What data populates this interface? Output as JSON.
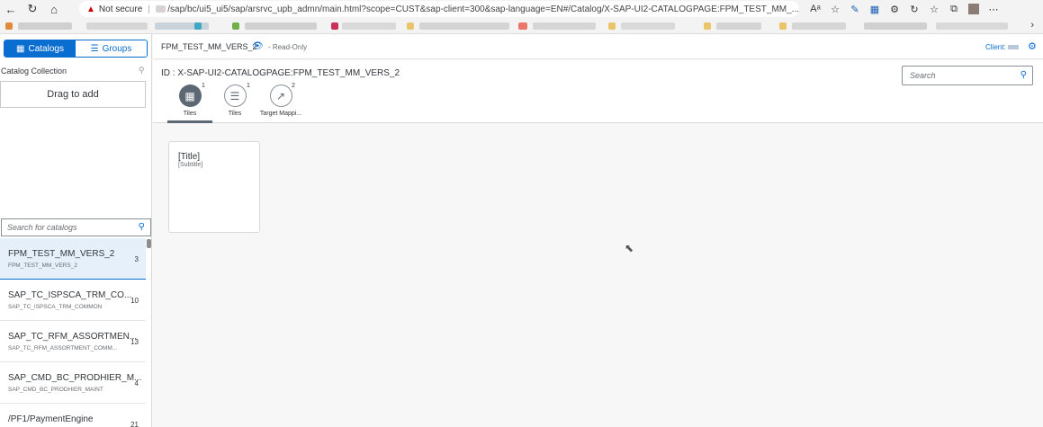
{
  "browser": {
    "security_label": "Not secure",
    "url": "/sap/bc/ui5_ui5/sap/arsrvc_upb_admn/main.html?scope=CUST&sap-client=300&sap-language=EN#/Catalog/X-SAP-UI2-CATALOGPAGE:FPM_TEST_MM_..."
  },
  "sidebar": {
    "seg_catalogs": "Catalogs",
    "seg_groups": "Groups",
    "collection_label": "Catalog Collection",
    "drop_label": "Drag to add",
    "search_placeholder": "Search for catalogs",
    "items": [
      {
        "title": "FPM_TEST_MM_VERS_2",
        "subtitle": "FPM_TEST_MM_VERS_2",
        "count": "3"
      },
      {
        "title": "SAP_TC_ISPSCA_TRM_CO...",
        "subtitle": "SAP_TC_ISPSCA_TRM_COMMON",
        "count": "10"
      },
      {
        "title": "SAP_TC_RFM_ASSORTMEN...",
        "subtitle": "SAP_TC_RFM_ASSORTMENT_COMM...",
        "count": "13"
      },
      {
        "title": "SAP_CMD_BC_PRODHIER_M...",
        "subtitle": "SAP_CMD_BC_PRODHIER_MAINT",
        "count": "4"
      },
      {
        "title": "/PF1/PaymentEngine",
        "subtitle": "",
        "count": "21"
      }
    ]
  },
  "header": {
    "title": "FPM_TEST_MM_VERS_2",
    "readonly": "- Read-Only",
    "client_label": "Client:"
  },
  "object": {
    "id_label": "ID : X-SAP-UI2-CATALOGPAGE:FPM_TEST_MM_VERS_2",
    "search_placeholder": "Search",
    "tabs": [
      {
        "label": "Tiles",
        "count": "1"
      },
      {
        "label": "Tiles",
        "count": "1"
      },
      {
        "label": "Target Mappi...",
        "count": "2"
      }
    ]
  },
  "tile": {
    "title": "[Title]",
    "subtitle": "[Subtitle]"
  },
  "colors": {
    "accent": "#0a6ed1",
    "selected_tab": "#5b6772",
    "selected_row": "#e5f0fa"
  }
}
